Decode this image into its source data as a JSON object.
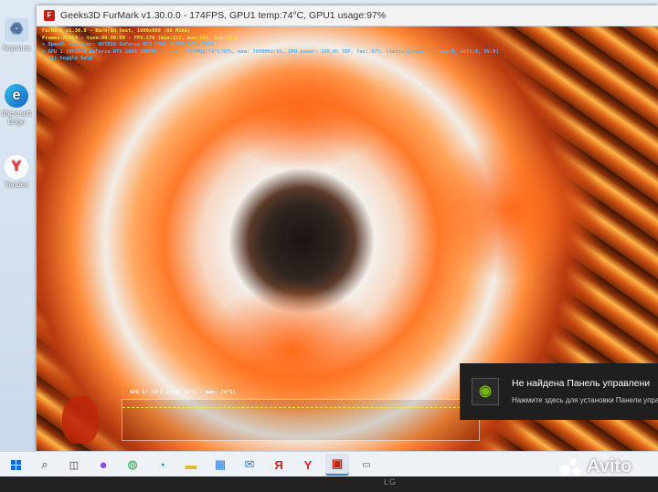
{
  "window": {
    "title": "Geeks3D FurMark v1.30.0.0 - 174FPS, GPU1 temp:74°C, GPU1 usage:97%"
  },
  "desktop": {
    "icons": [
      {
        "label": "Корзина",
        "icon": "recycle-bin-icon"
      },
      {
        "label": "Microsoft Edge",
        "icon": "edge-icon"
      },
      {
        "label": "Yandex",
        "icon": "yandex-icon"
      }
    ]
  },
  "hud": {
    "line1": "FurMark v1.30.0 - Burn-in test, 1600x900 (0X MSAA)",
    "line2": "Frames:85014 - time:00:08:09 - FPS:174 (min:117, max:191, avg:173)",
    "line3": "> OpenGL renderer: NVIDIA GeForce RTX 2060 SUPER/PCIe/SSE2",
    "line4": "> GPU 1 (NVIDIA GeForce RTX 2060 SUPER) - core: 1710MHz/74°C/97%, mem: 7000MHz/6%, GPU power: 100.0% TDP, fan: 67%, limits:[power:1, temp:0, volt:0, OV:0]",
    "line5": "- F1: toggle help"
  },
  "graph": {
    "label": "GPU 1: 74°C (min: 54°C - max: 74°C)"
  },
  "toast": {
    "title": "Не найдена Панель управлени",
    "body": "Нажмите здесь для установки Панели управл"
  },
  "taskbar": {
    "items": [
      "start-button",
      "search-icon",
      "task-view-icon",
      "alice-icon",
      "chrome-icon",
      "edge-icon",
      "file-explorer-icon",
      "store-icon",
      "mail-icon",
      "yandex-icon",
      "yandex-browser-icon",
      "furmark-icon"
    ]
  },
  "monitor": {
    "brand": "LG"
  },
  "watermark": {
    "text": "Avito"
  },
  "colors": {
    "hud_yellow": "#ffe14a",
    "hud_blue": "#53b7ff",
    "nvidia_green": "#76b900",
    "toast_bg": "#1f1f1f"
  }
}
